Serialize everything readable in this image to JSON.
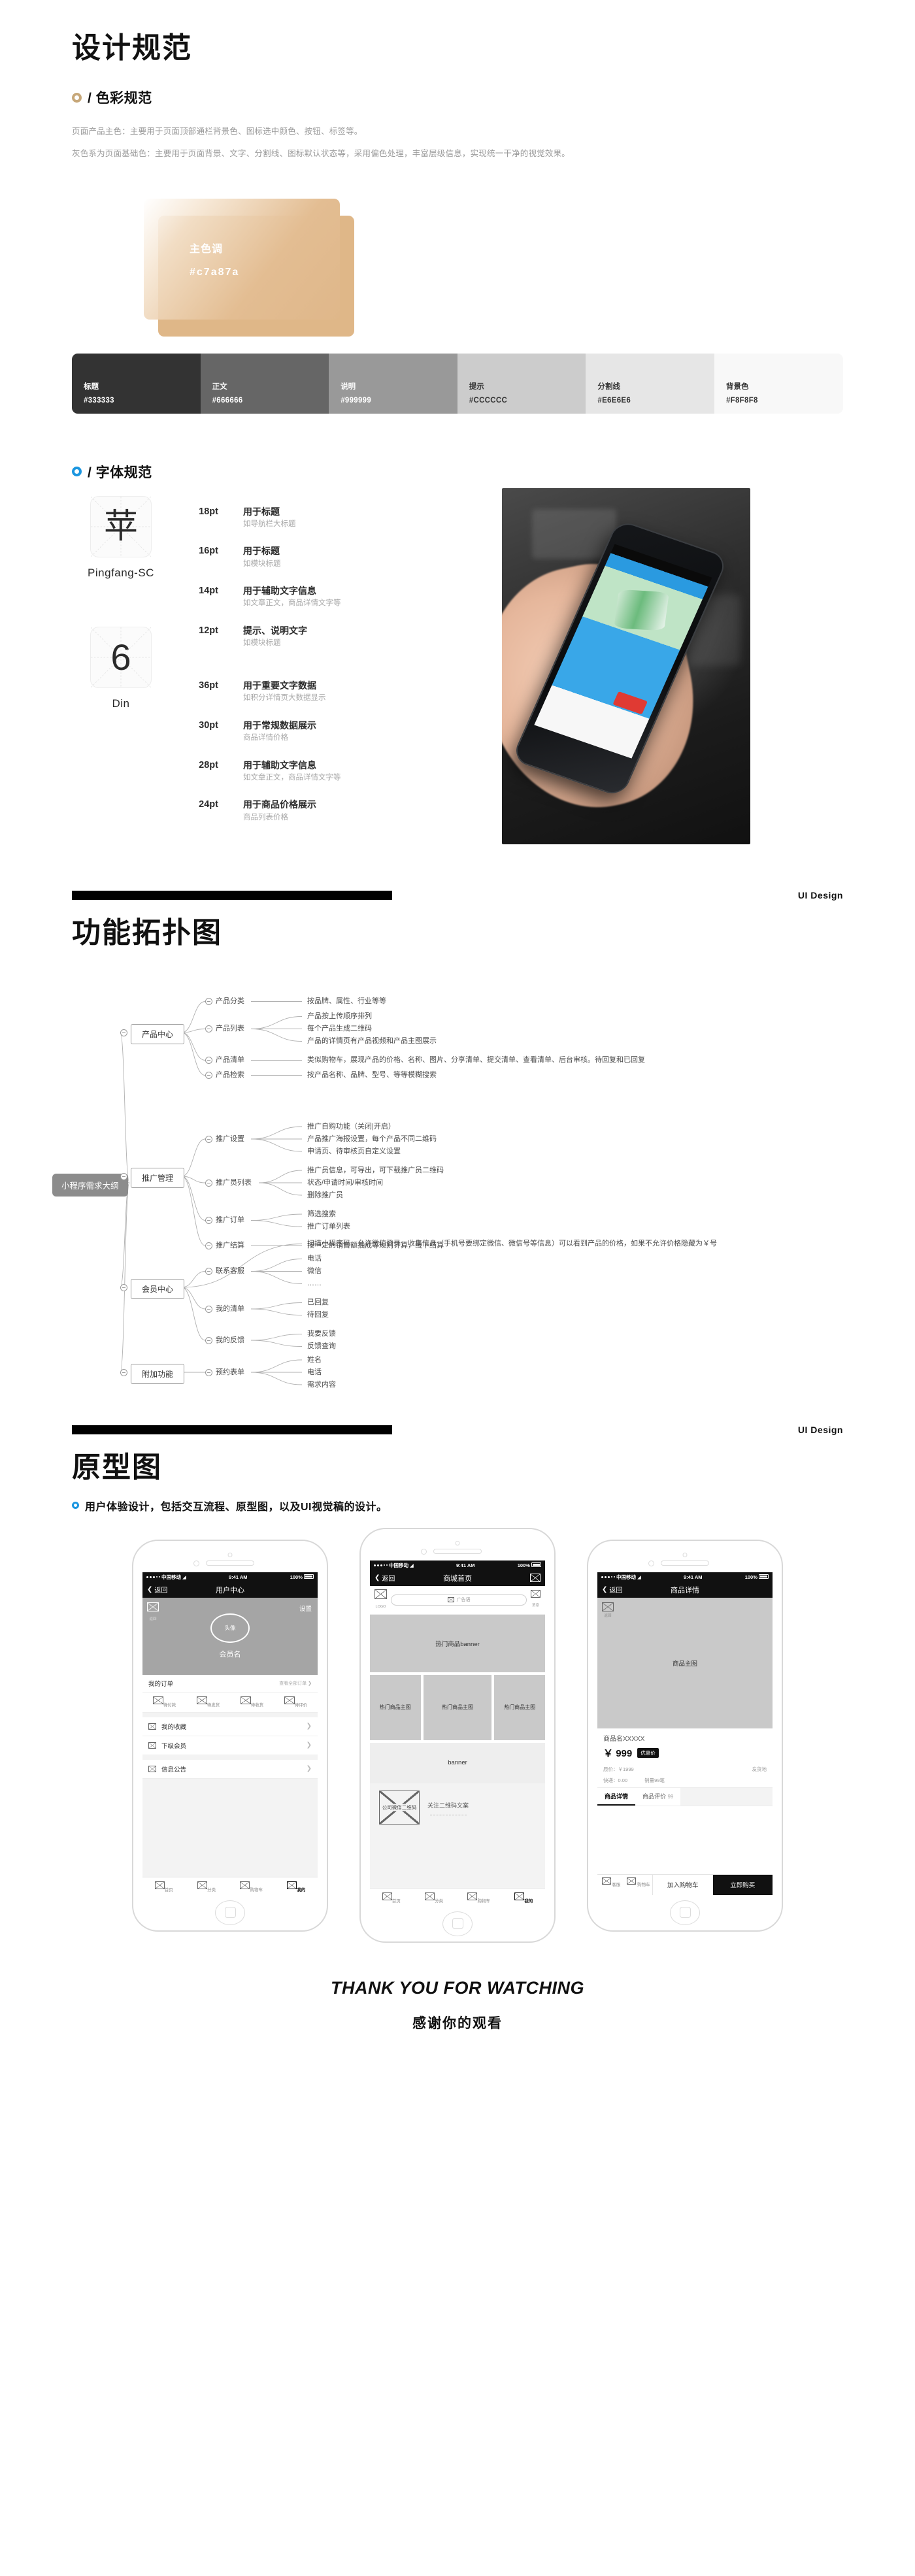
{
  "colors": {
    "primary": "#c7a87a",
    "accent_blue": "#1b96e0"
  },
  "section_color": {
    "title": "设计规范",
    "sub_head": "/ 色彩规范",
    "desc_1": "页面产品主色：主要用于页面顶部通栏背景色、图标选中颜色、按钮、标签等。",
    "desc_2": "灰色系为页面基础色：主要用于页面背景、文字、分割线、图标默认状态等，采用偏色处理，丰富层级信息，实现统一干净的视觉效果。",
    "primary_swatch": {
      "name": "主色调",
      "hex": "#c7a87a"
    },
    "grays": [
      {
        "name": "标题",
        "hex": "#333333",
        "bg": "#333333",
        "fg": "#ffffff"
      },
      {
        "name": "正文",
        "hex": "#666666",
        "bg": "#666666",
        "fg": "#ffffff"
      },
      {
        "name": "说明",
        "hex": "#999999",
        "bg": "#999999",
        "fg": "#ffffff"
      },
      {
        "name": "提示",
        "hex": "#CCCCCC",
        "bg": "#CCCCCC",
        "fg": "#333333"
      },
      {
        "name": "分割线",
        "hex": "#E6E6E6",
        "bg": "#E6E6E6",
        "fg": "#333333"
      },
      {
        "name": "背景色",
        "hex": "#F8F8F8",
        "bg": "#F8F8F8",
        "fg": "#333333"
      }
    ]
  },
  "section_font": {
    "sub_head": "/ 字体规范",
    "families": [
      {
        "sample_glyph": "苹",
        "name": "Pingfang-SC",
        "sizes": [
          {
            "pt": "18pt",
            "use": "用于标题",
            "note": "如导航栏大标题"
          },
          {
            "pt": "16pt",
            "use": "用于标题",
            "note": "如模块标题"
          },
          {
            "pt": "14pt",
            "use": "用于辅助文字信息",
            "note": "如文章正文，商品详情文字等"
          },
          {
            "pt": "12pt",
            "use": "提示、说明文字",
            "note": "如模块标题"
          }
        ]
      },
      {
        "sample_glyph": "6",
        "name": "Din",
        "sizes": [
          {
            "pt": "36pt",
            "use": "用于重要文字数据",
            "note": "如积分详情页大数据显示"
          },
          {
            "pt": "30pt",
            "use": "用于常规数据展示",
            "note": "商品详情价格"
          },
          {
            "pt": "28pt",
            "use": "用于辅助文字信息",
            "note": "如文章正文，商品详情文字等"
          },
          {
            "pt": "24pt",
            "use": "用于商品价格展示",
            "note": "商品列表价格"
          }
        ]
      }
    ]
  },
  "band_1": {
    "label": "UI Design"
  },
  "band_2": {
    "label": "UI Design"
  },
  "section_topology": {
    "title": "功能拓扑图",
    "root": "小程序需求大纲",
    "branches": [
      {
        "name": "产品中心",
        "children": [
          {
            "name": "产品分类",
            "leaves": [
              "按品牌、属性、行业等等"
            ]
          },
          {
            "name": "产品列表",
            "leaves": [
              "产品按上传顺序排列",
              "每个产品生成二维码",
              "产品的详情页有产品视频和产品主图展示"
            ]
          },
          {
            "name": "产品清单",
            "leaves": [
              "类似购物车，展现产品的价格、名称、图片、分享清单、提交清单、查看清单、后台审核。待回复和已回复"
            ]
          },
          {
            "name": "产品检索",
            "leaves": [
              "按产品名称、品牌、型号、等等模糊搜索"
            ]
          }
        ]
      },
      {
        "name": "推广管理",
        "children": [
          {
            "name": "推广设置",
            "leaves": [
              "推广自购功能（关闭|开启）",
              "产品推广海报设置，每个产品不同二维码",
              "申请页、待审核页自定义设置"
            ]
          },
          {
            "name": "推广员列表",
            "leaves": [
              "推广员信息，可导出，可下载推广员二维码",
              "状态/申请时间/审核时间",
              "删除推广员"
            ]
          },
          {
            "name": "推广订单",
            "leaves": [
              "筛选搜索",
              "推广订单列表"
            ]
          },
          {
            "name": "推广结算",
            "leaves": [
              "按一定的销售额抽成等规则计算，线下结算"
            ]
          }
        ]
      },
      {
        "name": "会员中心",
        "children": [
          {
            "name": "",
            "leaves": [
              "扫描小程序码，允许微信登录，收集信息（手机号要绑定微信、微信号等信息）可以看到产品的价格，如果不允许价格隐藏为￥号"
            ]
          },
          {
            "name": "联系客服",
            "leaves": [
              "电话",
              "微信",
              "……"
            ]
          },
          {
            "name": "我的清单",
            "leaves": [
              "已回复",
              "待回复"
            ]
          },
          {
            "name": "我的反馈",
            "leaves": [
              "我要反馈",
              "反馈查询"
            ]
          }
        ]
      },
      {
        "name": "附加功能",
        "children": [
          {
            "name": "预约表单",
            "leaves": [
              "姓名",
              "电话",
              "需求内容"
            ]
          }
        ]
      }
    ]
  },
  "section_proto": {
    "title": "原型图",
    "sub_head": "用户体验设计，包括交互流程、原型图，以及UI视觉稿的设计。",
    "phones": [
      {
        "status": {
          "carrier": "中国移动",
          "time": "9:41 AM",
          "battery": "100%"
        },
        "nav": {
          "back": "返回",
          "title": "用户中心",
          "right": ""
        },
        "hero": {
          "corner_label": "返回",
          "settings": "设置",
          "avatar": "头像",
          "member_name": "会员名"
        },
        "order_row": {
          "label": "我的订单",
          "link": "查看全部订单"
        },
        "order_states": [
          "待付款",
          "待发货",
          "待收货",
          "待评价"
        ],
        "menu": [
          "我的收藏",
          "下级会员",
          "信息公告"
        ],
        "tabbar": [
          "首页",
          "分类",
          "购物车",
          "我的"
        ]
      },
      {
        "status": {
          "carrier": "中国移动",
          "time": "9:41 AM",
          "battery": "100%"
        },
        "nav": {
          "back": "返回",
          "title": "商城首页",
          "right": "menu-icon"
        },
        "search": {
          "logo": "LOGO",
          "icon": "搜索",
          "placeholder": "广告语",
          "right": "消息"
        },
        "banner_top": "热门商品banner",
        "grid": [
          "热门商品主图",
          "热门商品主图",
          "热门商品主图"
        ],
        "banner_mid": "banner",
        "qr": {
          "box": "公司微信二维码",
          "caption": "关注二维码文案"
        },
        "tabbar": [
          "首页",
          "分类",
          "购物车",
          "我的"
        ]
      },
      {
        "status": {
          "carrier": "中国移动",
          "time": "9:41 AM",
          "battery": "100%"
        },
        "nav": {
          "back": "返回",
          "title": "商品详情",
          "right": ""
        },
        "hero": {
          "corner_label": "返回",
          "main_image": "商品主图"
        },
        "product": {
          "name": "商品名XXXXX",
          "currency": "￥",
          "price": "999",
          "tag": "优惠价",
          "original": "原价：￥1999",
          "shipping_from": "发货地",
          "express": "快递：0.00",
          "sales": "销量99笔"
        },
        "tabs": [
          {
            "label": "商品详情",
            "active": true
          },
          {
            "label": "商品评价",
            "count": "99",
            "active": false
          }
        ],
        "buybar": {
          "service": "客服",
          "cart": "购物车",
          "add_cart": "加入购物车",
          "buy_now": "立即购买"
        }
      }
    ]
  },
  "footer": {
    "thanks_en": "THANK YOU FOR WATCHING",
    "thanks_cn": "感谢你的观看"
  }
}
